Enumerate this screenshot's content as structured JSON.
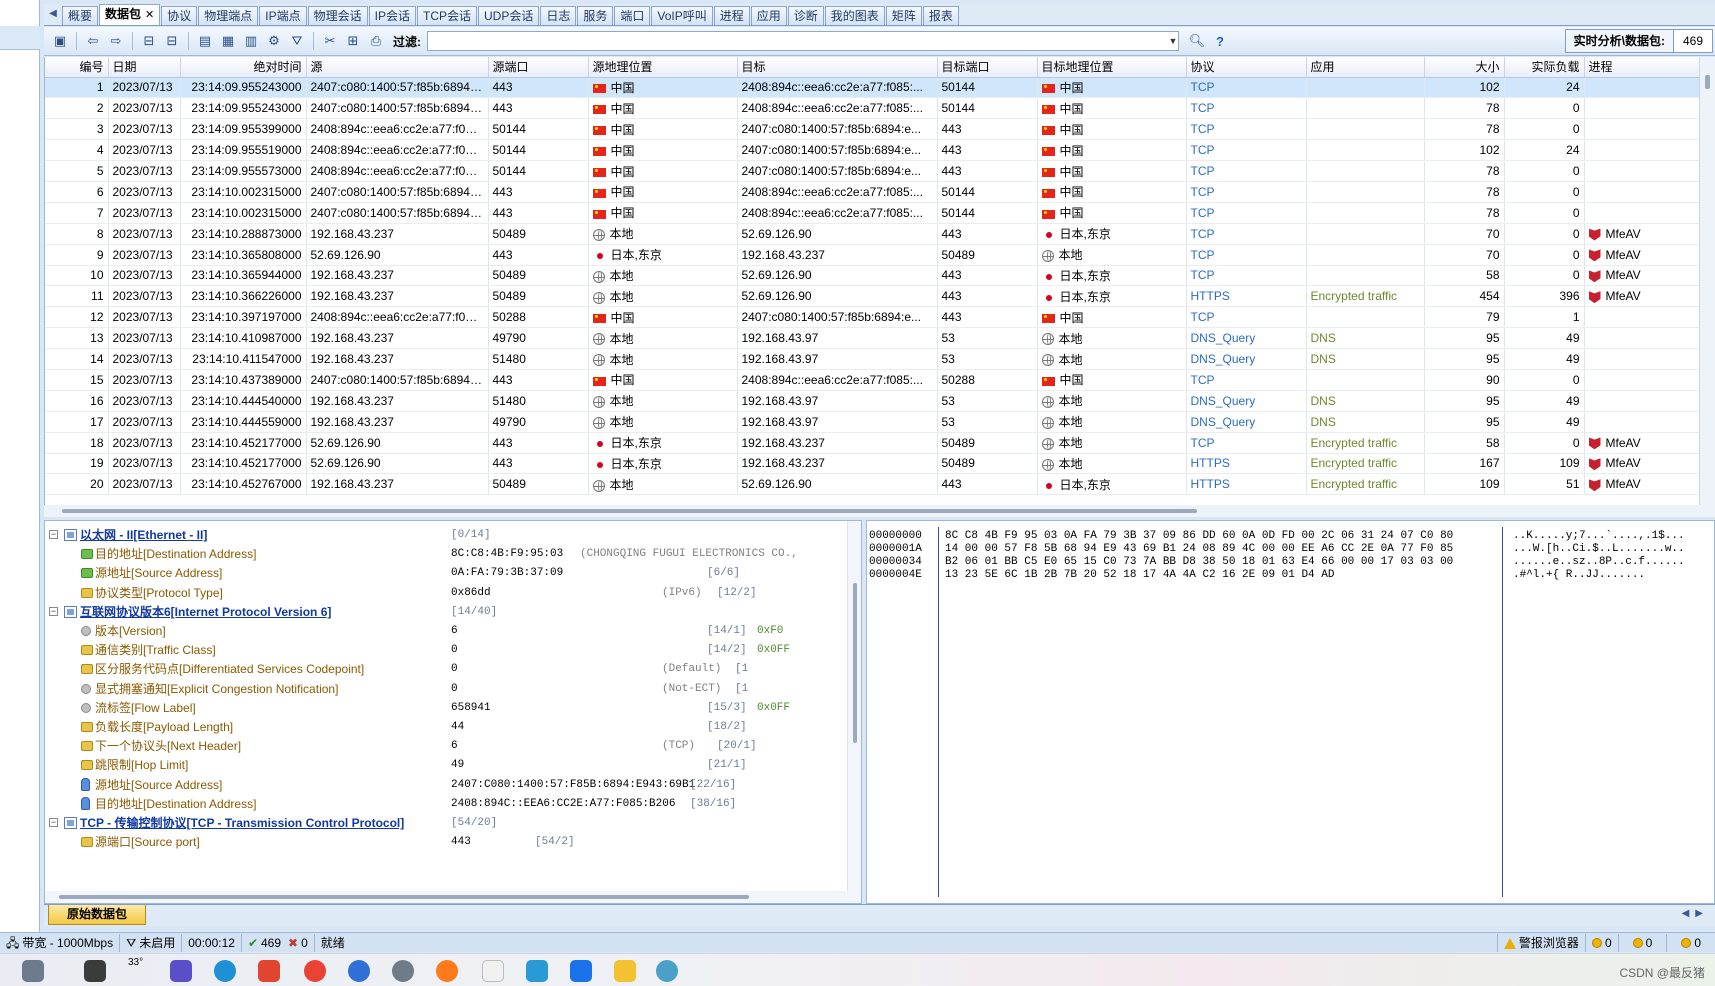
{
  "tabs": [
    "概要",
    "数据包",
    "协议",
    "物理端点",
    "IP端点",
    "物理会话",
    "IP会话",
    "TCP会话",
    "UDP会话",
    "日志",
    "服务",
    "端口",
    "VoIP呼叫",
    "进程",
    "应用",
    "诊断",
    "我的图表",
    "矩阵",
    "报表"
  ],
  "active_tab_index": 1,
  "toolbar": {
    "filter_label": "过滤:",
    "filter_value": "",
    "realtime_label": "实时分析\\数据包:",
    "realtime_value": "469"
  },
  "packet_table": {
    "columns": [
      "编号",
      "日期",
      "绝对时间",
      "源",
      "源端口",
      "源地理位置",
      "目标",
      "目标端口",
      "目标地理位置",
      "协议",
      "应用",
      "大小",
      "实际负载",
      "进程"
    ],
    "selected_row": 0,
    "rows": [
      {
        "no": "1",
        "date": "2023/07/13",
        "time": "23:14:09.955243000",
        "src": "2407:c080:1400:57:f85b:6894:e...",
        "sport": "443",
        "sgeo": "中国",
        "sgeo_type": "cn",
        "dst": "2408:894c::eea6:cc2e:a77:f085:...",
        "dport": "50144",
        "dgeo": "中国",
        "dgeo_type": "cn",
        "proto": "TCP",
        "app": "",
        "size": "102",
        "payload": "24",
        "proc": ""
      },
      {
        "no": "2",
        "date": "2023/07/13",
        "time": "23:14:09.955243000",
        "src": "2407:c080:1400:57:f85b:6894:e...",
        "sport": "443",
        "sgeo": "中国",
        "sgeo_type": "cn",
        "dst": "2408:894c::eea6:cc2e:a77:f085:...",
        "dport": "50144",
        "dgeo": "中国",
        "dgeo_type": "cn",
        "proto": "TCP",
        "app": "",
        "size": "78",
        "payload": "0",
        "proc": ""
      },
      {
        "no": "3",
        "date": "2023/07/13",
        "time": "23:14:09.955399000",
        "src": "2408:894c::eea6:cc2e:a77:f085:...",
        "sport": "50144",
        "sgeo": "中国",
        "sgeo_type": "cn",
        "dst": "2407:c080:1400:57:f85b:6894:e...",
        "dport": "443",
        "dgeo": "中国",
        "dgeo_type": "cn",
        "proto": "TCP",
        "app": "",
        "size": "78",
        "payload": "0",
        "proc": ""
      },
      {
        "no": "4",
        "date": "2023/07/13",
        "time": "23:14:09.955519000",
        "src": "2408:894c::eea6:cc2e:a77:f085:...",
        "sport": "50144",
        "sgeo": "中国",
        "sgeo_type": "cn",
        "dst": "2407:c080:1400:57:f85b:6894:e...",
        "dport": "443",
        "dgeo": "中国",
        "dgeo_type": "cn",
        "proto": "TCP",
        "app": "",
        "size": "102",
        "payload": "24",
        "proc": ""
      },
      {
        "no": "5",
        "date": "2023/07/13",
        "time": "23:14:09.955573000",
        "src": "2408:894c::eea6:cc2e:a77:f085:...",
        "sport": "50144",
        "sgeo": "中国",
        "sgeo_type": "cn",
        "dst": "2407:c080:1400:57:f85b:6894:e...",
        "dport": "443",
        "dgeo": "中国",
        "dgeo_type": "cn",
        "proto": "TCP",
        "app": "",
        "size": "78",
        "payload": "0",
        "proc": ""
      },
      {
        "no": "6",
        "date": "2023/07/13",
        "time": "23:14:10.002315000",
        "src": "2407:c080:1400:57:f85b:6894:e...",
        "sport": "443",
        "sgeo": "中国",
        "sgeo_type": "cn",
        "dst": "2408:894c::eea6:cc2e:a77:f085:...",
        "dport": "50144",
        "dgeo": "中国",
        "dgeo_type": "cn",
        "proto": "TCP",
        "app": "",
        "size": "78",
        "payload": "0",
        "proc": ""
      },
      {
        "no": "7",
        "date": "2023/07/13",
        "time": "23:14:10.002315000",
        "src": "2407:c080:1400:57:f85b:6894:e...",
        "sport": "443",
        "sgeo": "中国",
        "sgeo_type": "cn",
        "dst": "2408:894c::eea6:cc2e:a77:f085:...",
        "dport": "50144",
        "dgeo": "中国",
        "dgeo_type": "cn",
        "proto": "TCP",
        "app": "",
        "size": "78",
        "payload": "0",
        "proc": ""
      },
      {
        "no": "8",
        "date": "2023/07/13",
        "time": "23:14:10.288873000",
        "src": "192.168.43.237",
        "sport": "50489",
        "sgeo": "本地",
        "sgeo_type": "local",
        "dst": "52.69.126.90",
        "dport": "443",
        "dgeo": "日本,东京",
        "dgeo_type": "jp",
        "proto": "TCP",
        "app": "",
        "size": "70",
        "payload": "0",
        "proc": "MfeAV"
      },
      {
        "no": "9",
        "date": "2023/07/13",
        "time": "23:14:10.365808000",
        "src": "52.69.126.90",
        "sport": "443",
        "sgeo": "日本,东京",
        "sgeo_type": "jp",
        "dst": "192.168.43.237",
        "dport": "50489",
        "dgeo": "本地",
        "dgeo_type": "local",
        "proto": "TCP",
        "app": "",
        "size": "70",
        "payload": "0",
        "proc": "MfeAV"
      },
      {
        "no": "10",
        "date": "2023/07/13",
        "time": "23:14:10.365944000",
        "src": "192.168.43.237",
        "sport": "50489",
        "sgeo": "本地",
        "sgeo_type": "local",
        "dst": "52.69.126.90",
        "dport": "443",
        "dgeo": "日本,东京",
        "dgeo_type": "jp",
        "proto": "TCP",
        "app": "",
        "size": "58",
        "payload": "0",
        "proc": "MfeAV"
      },
      {
        "no": "11",
        "date": "2023/07/13",
        "time": "23:14:10.366226000",
        "src": "192.168.43.237",
        "sport": "50489",
        "sgeo": "本地",
        "sgeo_type": "local",
        "dst": "52.69.126.90",
        "dport": "443",
        "dgeo": "日本,东京",
        "dgeo_type": "jp",
        "proto": "HTTPS",
        "app": "Encrypted traffic",
        "size": "454",
        "payload": "396",
        "proc": "MfeAV"
      },
      {
        "no": "12",
        "date": "2023/07/13",
        "time": "23:14:10.397197000",
        "src": "2408:894c::eea6:cc2e:a77:f085:...",
        "sport": "50288",
        "sgeo": "中国",
        "sgeo_type": "cn",
        "dst": "2407:c080:1400:57:f85b:6894:e...",
        "dport": "443",
        "dgeo": "中国",
        "dgeo_type": "cn",
        "proto": "TCP",
        "app": "",
        "size": "79",
        "payload": "1",
        "proc": ""
      },
      {
        "no": "13",
        "date": "2023/07/13",
        "time": "23:14:10.410987000",
        "src": "192.168.43.237",
        "sport": "49790",
        "sgeo": "本地",
        "sgeo_type": "local",
        "dst": "192.168.43.97",
        "dport": "53",
        "dgeo": "本地",
        "dgeo_type": "local",
        "proto": "DNS_Query",
        "app": "DNS",
        "size": "95",
        "payload": "49",
        "proc": ""
      },
      {
        "no": "14",
        "date": "2023/07/13",
        "time": "23:14:10.411547000",
        "src": "192.168.43.237",
        "sport": "51480",
        "sgeo": "本地",
        "sgeo_type": "local",
        "dst": "192.168.43.97",
        "dport": "53",
        "dgeo": "本地",
        "dgeo_type": "local",
        "proto": "DNS_Query",
        "app": "DNS",
        "size": "95",
        "payload": "49",
        "proc": ""
      },
      {
        "no": "15",
        "date": "2023/07/13",
        "time": "23:14:10.437389000",
        "src": "2407:c080:1400:57:f85b:6894:e...",
        "sport": "443",
        "sgeo": "中国",
        "sgeo_type": "cn",
        "dst": "2408:894c::eea6:cc2e:a77:f085:...",
        "dport": "50288",
        "dgeo": "中国",
        "dgeo_type": "cn",
        "proto": "TCP",
        "app": "",
        "size": "90",
        "payload": "0",
        "proc": ""
      },
      {
        "no": "16",
        "date": "2023/07/13",
        "time": "23:14:10.444540000",
        "src": "192.168.43.237",
        "sport": "51480",
        "sgeo": "本地",
        "sgeo_type": "local",
        "dst": "192.168.43.97",
        "dport": "53",
        "dgeo": "本地",
        "dgeo_type": "local",
        "proto": "DNS_Query",
        "app": "DNS",
        "size": "95",
        "payload": "49",
        "proc": ""
      },
      {
        "no": "17",
        "date": "2023/07/13",
        "time": "23:14:10.444559000",
        "src": "192.168.43.237",
        "sport": "49790",
        "sgeo": "本地",
        "sgeo_type": "local",
        "dst": "192.168.43.97",
        "dport": "53",
        "dgeo": "本地",
        "dgeo_type": "local",
        "proto": "DNS_Query",
        "app": "DNS",
        "size": "95",
        "payload": "49",
        "proc": ""
      },
      {
        "no": "18",
        "date": "2023/07/13",
        "time": "23:14:10.452177000",
        "src": "52.69.126.90",
        "sport": "443",
        "sgeo": "日本,东京",
        "sgeo_type": "jp",
        "dst": "192.168.43.237",
        "dport": "50489",
        "dgeo": "本地",
        "dgeo_type": "local",
        "proto": "TCP",
        "app": "Encrypted traffic",
        "size": "58",
        "payload": "0",
        "proc": "MfeAV"
      },
      {
        "no": "19",
        "date": "2023/07/13",
        "time": "23:14:10.452177000",
        "src": "52.69.126.90",
        "sport": "443",
        "sgeo": "日本,东京",
        "sgeo_type": "jp",
        "dst": "192.168.43.237",
        "dport": "50489",
        "dgeo": "本地",
        "dgeo_type": "local",
        "proto": "HTTPS",
        "app": "Encrypted traffic",
        "size": "167",
        "payload": "109",
        "proc": "MfeAV"
      },
      {
        "no": "20",
        "date": "2023/07/13",
        "time": "23:14:10.452767000",
        "src": "192.168.43.237",
        "sport": "50489",
        "sgeo": "本地",
        "sgeo_type": "local",
        "dst": "52.69.126.90",
        "dport": "443",
        "dgeo": "日本,东京",
        "dgeo_type": "jp",
        "proto": "HTTPS",
        "app": "Encrypted traffic",
        "size": "109",
        "payload": "51",
        "proc": "MfeAV"
      }
    ]
  },
  "decode_tree": [
    {
      "level": 0,
      "kind": "group",
      "expanded": true,
      "label": "以太网 - II[Ethernet - II]",
      "value": "",
      "extra": "",
      "pos": "[0/14]",
      "mask": ""
    },
    {
      "level": 1,
      "kind": "green",
      "label": "目的地址[Destination Address]",
      "value": "8C:C8:4B:F9:95:03",
      "extra": "(CHONGQING FUGUI ELECTRONICS CO.,",
      "pos": "",
      "mask": ""
    },
    {
      "level": 1,
      "kind": "green",
      "label": "源地址[Source Address]",
      "value": "0A:FA:79:3B:37:09",
      "extra": "",
      "pos": "[6/6]",
      "mask": ""
    },
    {
      "level": 1,
      "kind": "field",
      "label": "协议类型[Protocol Type]",
      "value": "0x86dd",
      "extra": "(IPv6)",
      "pos": "[12/2]",
      "mask": ""
    },
    {
      "level": 0,
      "kind": "group",
      "expanded": true,
      "label": "互联网协议版本6[Internet Protocol Version 6]",
      "value": "",
      "extra": "",
      "pos": "[14/40]",
      "mask": ""
    },
    {
      "level": 1,
      "kind": "gray",
      "label": "版本[Version]",
      "value": "6",
      "extra": "",
      "pos": "[14/1]",
      "mask": "0xF0"
    },
    {
      "level": 1,
      "kind": "field",
      "label": "通信类别[Traffic Class]",
      "value": "0",
      "extra": "",
      "pos": "[14/2]",
      "mask": "0x0FF"
    },
    {
      "level": 1,
      "kind": "field",
      "label": "区分服务代码点[Differentiated Services Codepoint]",
      "value": "0",
      "extra": "(Default)",
      "pos": "[1",
      "mask": ""
    },
    {
      "level": 1,
      "kind": "gray",
      "label": "显式拥塞通知[Explicit Congestion Notification]",
      "value": "0",
      "extra": "(Not-ECT)",
      "pos": "[1",
      "mask": ""
    },
    {
      "level": 1,
      "kind": "gray",
      "label": "流标签[Flow Label]",
      "value": "658941",
      "extra": "",
      "pos": "[15/3]",
      "mask": "0x0FF"
    },
    {
      "level": 1,
      "kind": "field",
      "label": "负载长度[Payload Length]",
      "value": "44",
      "extra": "",
      "pos": "[18/2]",
      "mask": ""
    },
    {
      "level": 1,
      "kind": "field",
      "label": "下一个协议头[Next Header]",
      "value": "6",
      "extra": "(TCP)",
      "pos": "[20/1]",
      "mask": ""
    },
    {
      "level": 1,
      "kind": "field",
      "label": "跳限制[Hop Limit]",
      "value": "49",
      "extra": "",
      "pos": "[21/1]",
      "mask": ""
    },
    {
      "level": 1,
      "kind": "blue",
      "label": "源地址[Source Address]",
      "value": "2407:C080:1400:57:F85B:6894:E943:69B1",
      "extra": "",
      "pos": "[22/16]",
      "mask": ""
    },
    {
      "level": 1,
      "kind": "blue",
      "label": "目的地址[Destination Address]",
      "value": "2408:894C::EEA6:CC2E:A77:F085:B206",
      "extra": "",
      "pos": "[38/16]",
      "mask": ""
    },
    {
      "level": 0,
      "kind": "group",
      "expanded": true,
      "label": "TCP - 传输控制协议[TCP - Transmission Control Protocol]",
      "value": "",
      "extra": "",
      "pos": "[54/20]",
      "mask": ""
    },
    {
      "level": 1,
      "kind": "field",
      "label": "源端口[Source port]",
      "value": "443",
      "extra": "",
      "pos": "[54/2]",
      "mask": ""
    }
  ],
  "hex_dump": {
    "offsets": [
      "00000000",
      "0000001A",
      "00000034",
      "0000004E"
    ],
    "hex": [
      "8C C8 4B F9 95 03 0A FA 79 3B 37 09 86 DD 60 0A 0D FD 00 2C 06 31 24 07 C0 80",
      "14 00 00 57 F8 5B 68 94 E9 43 69 B1 24 08 89 4C 00 00 EE A6 CC 2E 0A 77 F0 85",
      "B2 06 01 BB C5 E0 65 15 C0 73 7A BB D8 38 50 18 01 63 E4 66 00 00 17 03 03 00",
      "13 23 5E 6C 1B 2B 7B 20 52 18 17 4A 4A C2 16 2E 09 01 D4 AD"
    ],
    "ascii": [
      "..K.....y;7...`....,.1$...",
      "...W.[h..Ci.$..L.......w..",
      "......e..sz..8P..c.f......",
      ".#^l.+{ R..JJ......."
    ]
  },
  "raw_tab": "原始数据包",
  "statusbar": {
    "bandwidth": "带宽 - 1000Mbps",
    "filter_state": "未启用",
    "elapsed": "00:00:12",
    "packets": "469",
    "dropped": "0",
    "ready": "就绪",
    "alarm": "警报浏览器",
    "c1": "0",
    "c2": "0",
    "c3": "0"
  },
  "taskbar": {
    "temp": "33°",
    "watermark": "CSDN @最反猪"
  }
}
